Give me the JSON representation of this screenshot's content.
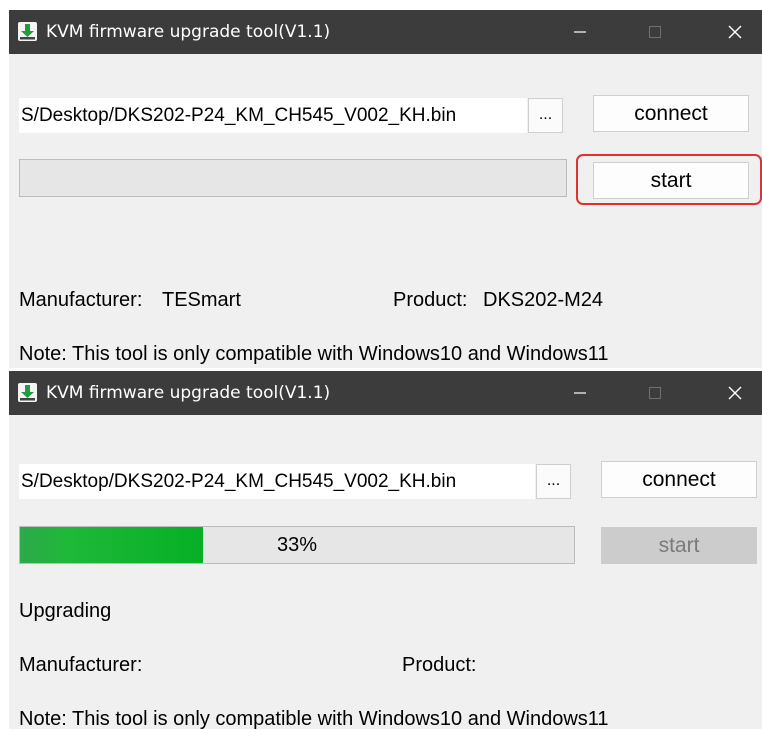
{
  "colors": {
    "titlebar": "#3c3c3c",
    "window": "#f0f0f0",
    "highlight": "#e03030",
    "progress_fill": "#06b025"
  },
  "windows": [
    {
      "title": "KVM firmware upgrade tool(V1.1)",
      "icons": {
        "app": "download-icon",
        "minimize": "minimize-icon",
        "maximize": "maximize-icon",
        "close": "close-icon"
      },
      "file_path": "S/Desktop/DKS202-P24_KM_CH545_V002_KH.bin",
      "browse_label": "...",
      "connect_label": "connect",
      "start_label": "start",
      "start_disabled": false,
      "start_highlighted": true,
      "progress": {
        "percent": 0,
        "text": ""
      },
      "status": "",
      "manufacturer_label": "Manufacturer:",
      "manufacturer_value": "TESmart",
      "product_label": "Product:",
      "product_value": "DKS202-M24",
      "note": "Note: This tool is only compatible with Windows10 and Windows11"
    },
    {
      "title": "KVM firmware upgrade tool(V1.1)",
      "icons": {
        "app": "download-icon",
        "minimize": "minimize-icon",
        "maximize": "maximize-icon",
        "close": "close-icon"
      },
      "file_path": "S/Desktop/DKS202-P24_KM_CH545_V002_KH.bin",
      "browse_label": "...",
      "connect_label": "connect",
      "start_label": "start",
      "start_disabled": true,
      "start_highlighted": false,
      "progress": {
        "percent": 33,
        "text": "33%"
      },
      "status": "Upgrading",
      "manufacturer_label": "Manufacturer:",
      "manufacturer_value": "",
      "product_label": "Product:",
      "product_value": "",
      "note": "Note: This tool is only compatible with Windows10 and Windows11"
    }
  ]
}
